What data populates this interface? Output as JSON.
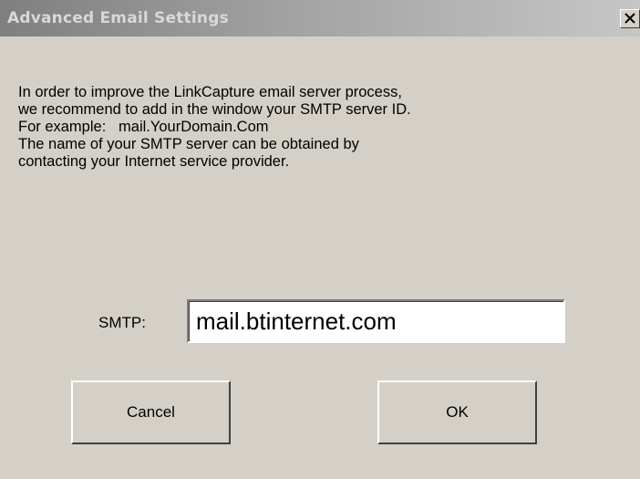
{
  "window": {
    "title": "Advanced Email Settings",
    "close_icon": "close-icon"
  },
  "message": {
    "lines": [
      "In order to improve the LinkCapture email server process,",
      "we recommend to add in the window your SMTP server ID.",
      "For example:   mail.YourDomain.Com",
      "The name of your SMTP server can be obtained by",
      "contacting your Internet service provider."
    ]
  },
  "smtp": {
    "label": "SMTP:",
    "value": "mail.btinternet.com"
  },
  "buttons": {
    "cancel_label": "Cancel",
    "ok_label": "OK"
  },
  "colors": {
    "dialog_background": "#d4d0c8",
    "title_bar_gradient_start": "#7f7f7f",
    "title_bar_gradient_end": "#c6c6c6",
    "title_text": "#d8d8d8"
  }
}
